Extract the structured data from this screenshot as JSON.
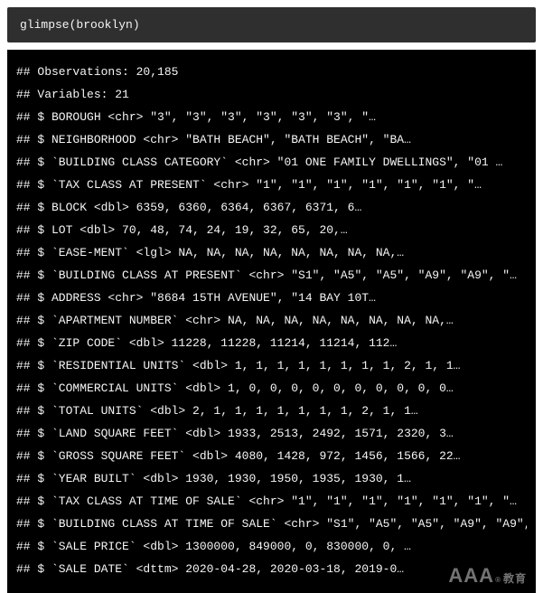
{
  "code": "glimpse(brooklyn)",
  "output": {
    "header": [
      "## Observations: 20,185",
      "## Variables: 21"
    ],
    "rows": [
      "## $ BOROUGH <chr> \"3\", \"3\", \"3\", \"3\", \"3\", \"3\", \"…",
      "## $ NEIGHBORHOOD <chr> \"BATH BEACH\", \"BATH BEACH\", \"BA…",
      "## $ `BUILDING CLASS CATEGORY` <chr> \"01 ONE FAMILY DWELLINGS\", \"01 …",
      "## $ `TAX CLASS AT PRESENT` <chr> \"1\", \"1\", \"1\", \"1\", \"1\", \"1\", \"…",
      "## $ BLOCK <dbl> 6359, 6360, 6364, 6367, 6371, 6…",
      "## $ LOT <dbl> 70, 48, 74, 24, 19, 32, 65, 20,…",
      "## $ `EASE-MENT` <lgl> NA, NA, NA, NA, NA, NA, NA, NA,…",
      "## $ `BUILDING CLASS AT PRESENT` <chr> \"S1\", \"A5\", \"A5\", \"A9\", \"A9\", \"…",
      "## $ ADDRESS <chr> \"8684 15TH AVENUE\", \"14 BAY 10T…",
      "## $ `APARTMENT NUMBER` <chr> NA, NA, NA, NA, NA, NA, NA, NA,…",
      "## $ `ZIP CODE` <dbl> 11228, 11228, 11214, 11214, 112…",
      "## $ `RESIDENTIAL UNITS` <dbl> 1, 1, 1, 1, 1, 1, 1, 1, 2, 1, 1…",
      "## $ `COMMERCIAL UNITS` <dbl> 1, 0, 0, 0, 0, 0, 0, 0, 0, 0, 0…",
      "## $ `TOTAL UNITS` <dbl> 2, 1, 1, 1, 1, 1, 1, 1, 2, 1, 1…",
      "## $ `LAND SQUARE FEET` <dbl> 1933, 2513, 2492, 1571, 2320, 3…",
      "## $ `GROSS SQUARE FEET` <dbl> 4080, 1428, 972, 1456, 1566, 22…",
      "## $ `YEAR BUILT` <dbl> 1930, 1930, 1950, 1935, 1930, 1…",
      "## $ `TAX CLASS AT TIME OF SALE` <chr> \"1\", \"1\", \"1\", \"1\", \"1\", \"1\", \"…",
      "## $ `BUILDING CLASS AT TIME OF SALE` <chr> \"S1\", \"A5\", \"A5\", \"A9\", \"A9\", \"…",
      "## $ `SALE PRICE` <dbl> 1300000, 849000, 0, 830000, 0, …",
      "## $ `SALE DATE` <dttm> 2020-04-28, 2020-03-18, 2019-0…"
    ]
  },
  "watermark": {
    "big": "AAA",
    "small": "教育"
  }
}
